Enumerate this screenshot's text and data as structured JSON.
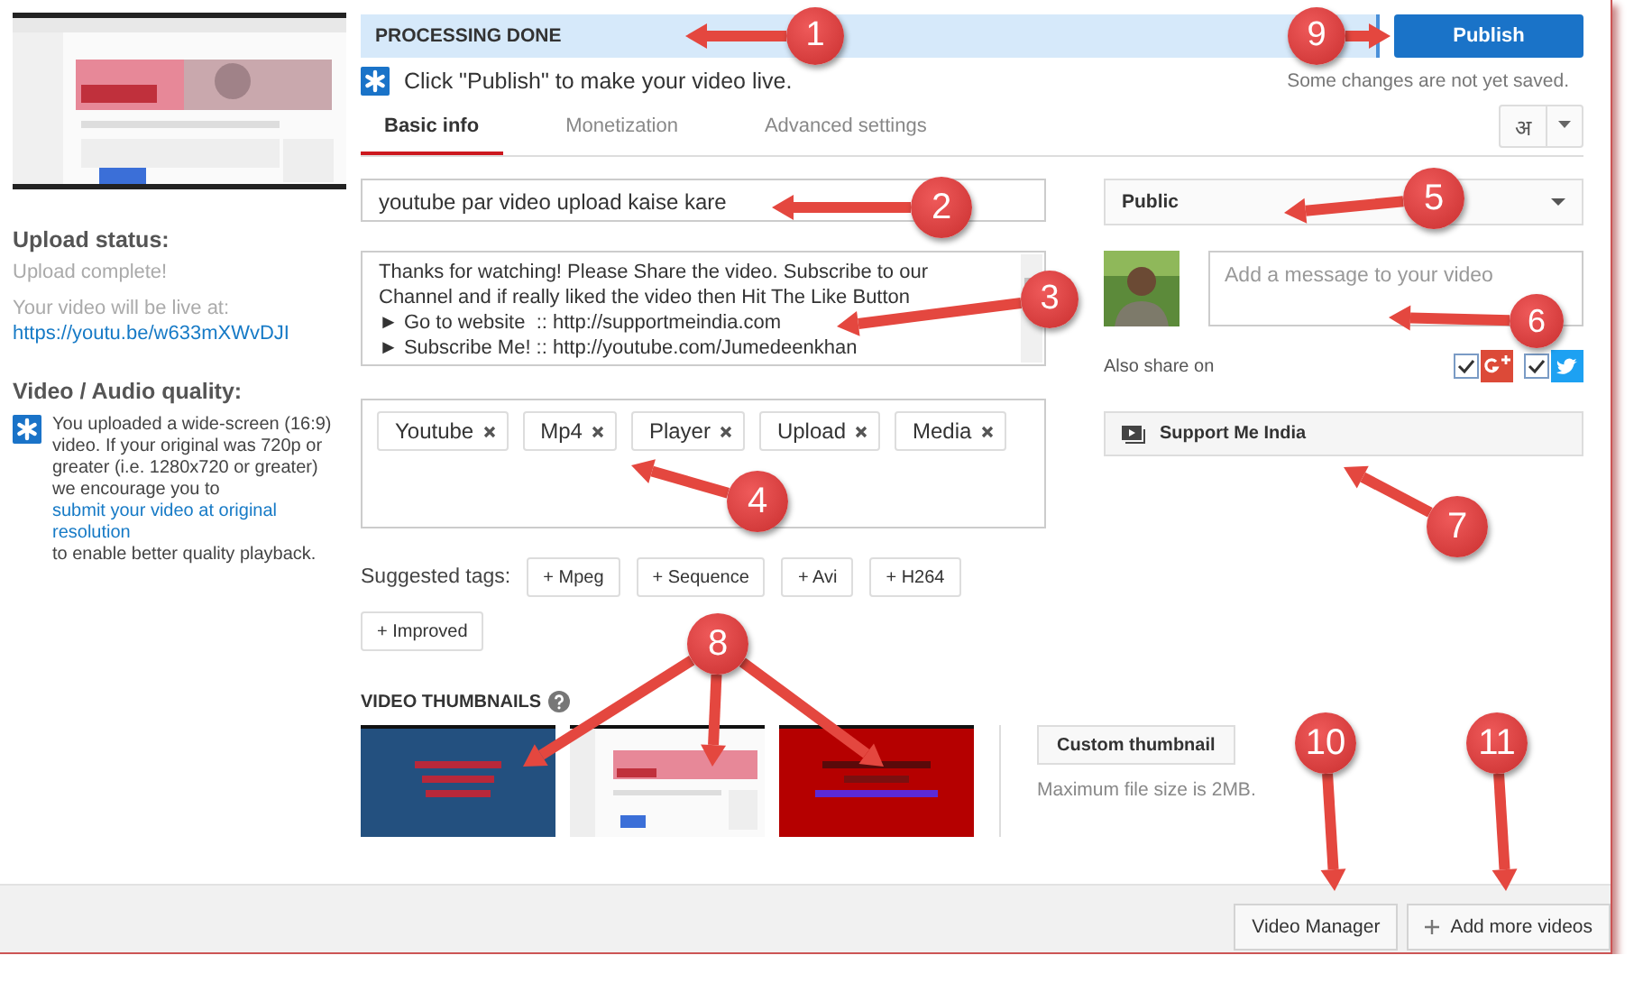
{
  "sidebar": {
    "upload_status_title": "Upload status:",
    "upload_status": "Upload complete!",
    "live_label": "Your video will be live at:",
    "video_link": "https://youtu.be/w633mXWvDJI",
    "quality_title": "Video / Audio quality:",
    "quality_text_before": "You uploaded a wide-screen (16:9) video. If your original was 720p or greater (i.e. 1280x720 or greater) we encourage you to ",
    "quality_link": "submit your video at original resolution",
    "quality_text_after": " to enable better quality playback."
  },
  "banner": {
    "status": "PROCESSING DONE"
  },
  "publish_button": "Publish",
  "notice": "Click \"Publish\" to make your video live.",
  "save_status": "Some changes are not yet saved.",
  "tabs": [
    {
      "label": "Basic info",
      "selected": true
    },
    {
      "label": "Monetization",
      "selected": false
    },
    {
      "label": "Advanced settings",
      "selected": false
    }
  ],
  "language_button": "अ",
  "title_field": {
    "value": "youtube par video upload kaise kare"
  },
  "description_field": {
    "value": "Thanks for watching! Please Share the video. Subscribe to our\nChannel and if really liked the video then Hit The Like Button\n► Go to website  :: http://supportmeindia.com\n► Subscribe Me! :: http://youtube.com/Jumedeenkhan"
  },
  "tags": [
    "Youtube",
    "Mp4",
    "Player",
    "Upload",
    "Media"
  ],
  "suggested_label": "Suggested tags:",
  "suggested_tags": [
    "+ Mpeg",
    "+ Sequence",
    "+ Avi",
    "+ H264",
    "+ Improved"
  ],
  "privacy": {
    "value": "Public"
  },
  "message_field": {
    "placeholder": "Add a message to your video"
  },
  "share_label": "Also share on",
  "share": [
    {
      "kind": "gplus",
      "checked": true
    },
    {
      "kind": "twitter",
      "checked": true
    }
  ],
  "playlist_button": "Support Me India",
  "thumbnails_title": "VIDEO THUMBNAILS",
  "custom_thumbnail_button": "Custom thumbnail",
  "max_file_size": "Maximum file size is 2MB.",
  "footer_buttons": [
    {
      "kind": "plain",
      "label": "Video Manager"
    },
    {
      "kind": "add",
      "label": "Add more videos"
    }
  ],
  "callouts": [
    "1",
    "2",
    "3",
    "4",
    "5",
    "6",
    "7",
    "8",
    "9",
    "10",
    "11"
  ]
}
